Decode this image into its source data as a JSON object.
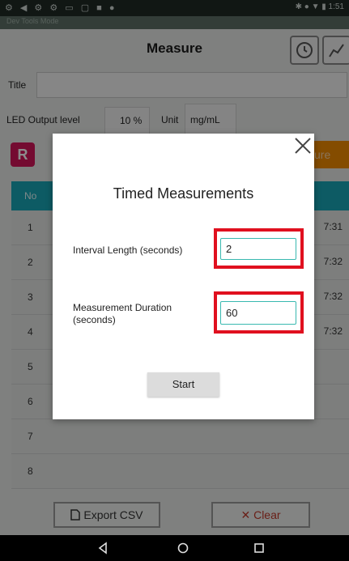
{
  "status_bar": {
    "left_icons": "⚙ ◀ ⚙ ⚙ ▭ ▢ ■ ●",
    "right_text": "✱ ● ▼ ▮ 1:51"
  },
  "app": {
    "strip_text": "Dev Tools Mode",
    "title": "Measure",
    "title_label": "Title",
    "led_label": "LED Output level",
    "led_value": "10 %",
    "unit_label": "Unit",
    "unit_value": "mg/mL",
    "r_button": "R",
    "orange_button": "ure",
    "table_header_no": "No",
    "rows": [
      {
        "no": "1",
        "time": "7:31"
      },
      {
        "no": "2",
        "time": "7:32"
      },
      {
        "no": "3",
        "time": "7:32"
      },
      {
        "no": "4",
        "time": "7:32"
      },
      {
        "no": "5",
        "time": ""
      },
      {
        "no": "6",
        "time": ""
      },
      {
        "no": "7",
        "time": ""
      },
      {
        "no": "8",
        "time": ""
      }
    ],
    "export_csv": "Export CSV",
    "clear": "Clear"
  },
  "dialog": {
    "title": "Timed Measurements",
    "interval_label": "Interval Length (seconds)",
    "interval_value": "2",
    "duration_label_1": "Measurement Duration",
    "duration_label_2": "(seconds)",
    "duration_value": "60",
    "start_button": "Start"
  },
  "colors": {
    "accent_teal": "#18a6b7",
    "highlight_red": "#e0101f",
    "r_button": "#d4145a",
    "orange": "#f08a00"
  }
}
